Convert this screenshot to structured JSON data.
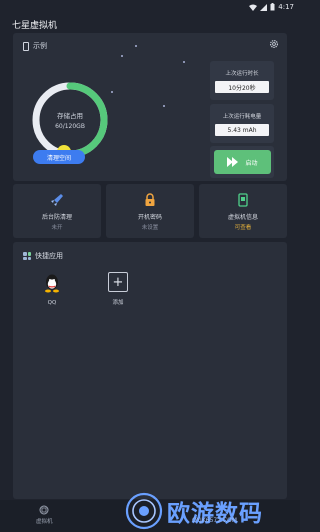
{
  "status_bar": {
    "time": "4:17"
  },
  "app": {
    "title": "七星虚拟机"
  },
  "device": {
    "name": "示例",
    "storage_title": "存储占用",
    "storage_value": "60/120GB",
    "storage_fraction": 0.5,
    "clean_button": "清理空间"
  },
  "stats": {
    "runtime_label": "上次运行时长",
    "runtime_value": "10分20秒",
    "power_label": "上次运行耗电量",
    "power_value": "5.43 mAh",
    "start_button": "启动"
  },
  "tiles": [
    {
      "label": "后台防清理",
      "sub": "未开"
    },
    {
      "label": "开机密码",
      "sub": "未设置"
    },
    {
      "label": "虚拟机信息",
      "sub": "可查看"
    }
  ],
  "quick_apps": {
    "title": "快捷应用",
    "apps": [
      {
        "label": "QQ",
        "icon": "qq-icon"
      }
    ],
    "add_label": "添加"
  },
  "bottom_nav": {
    "item": "虚拟机"
  },
  "watermark": {
    "text": "欧游数码",
    "url": "OYJK6572.COM"
  },
  "colors": {
    "accent": "#3d7cf0",
    "start": "#5ec07a",
    "ring": "#56c97b",
    "ring_knob": "#f0e23a"
  }
}
